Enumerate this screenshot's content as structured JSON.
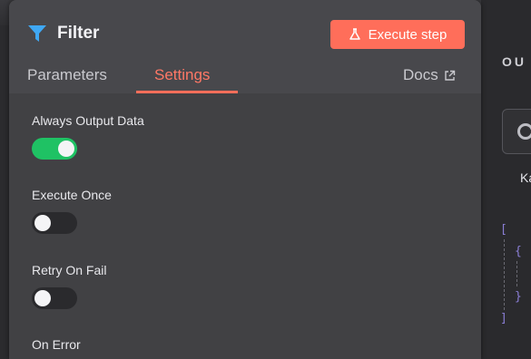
{
  "node": {
    "title": "Filter",
    "execute_button": "Execute step"
  },
  "tabs": {
    "parameters": "Parameters",
    "settings": "Settings",
    "docs": "Docs"
  },
  "settings": [
    {
      "label": "Always Output Data",
      "enabled": true
    },
    {
      "label": "Execute Once",
      "enabled": false
    },
    {
      "label": "Retry On Fail",
      "enabled": false
    },
    {
      "label": "On Error"
    }
  ],
  "output_pane": {
    "title": "OU",
    "partial_label": "Ka",
    "json_lines": [
      "[",
      "{",
      "}",
      "]"
    ]
  },
  "colors": {
    "accent": "#ff6e5a",
    "toggle_on": "#1fc264",
    "filter_icon": "#3fa8f4"
  }
}
